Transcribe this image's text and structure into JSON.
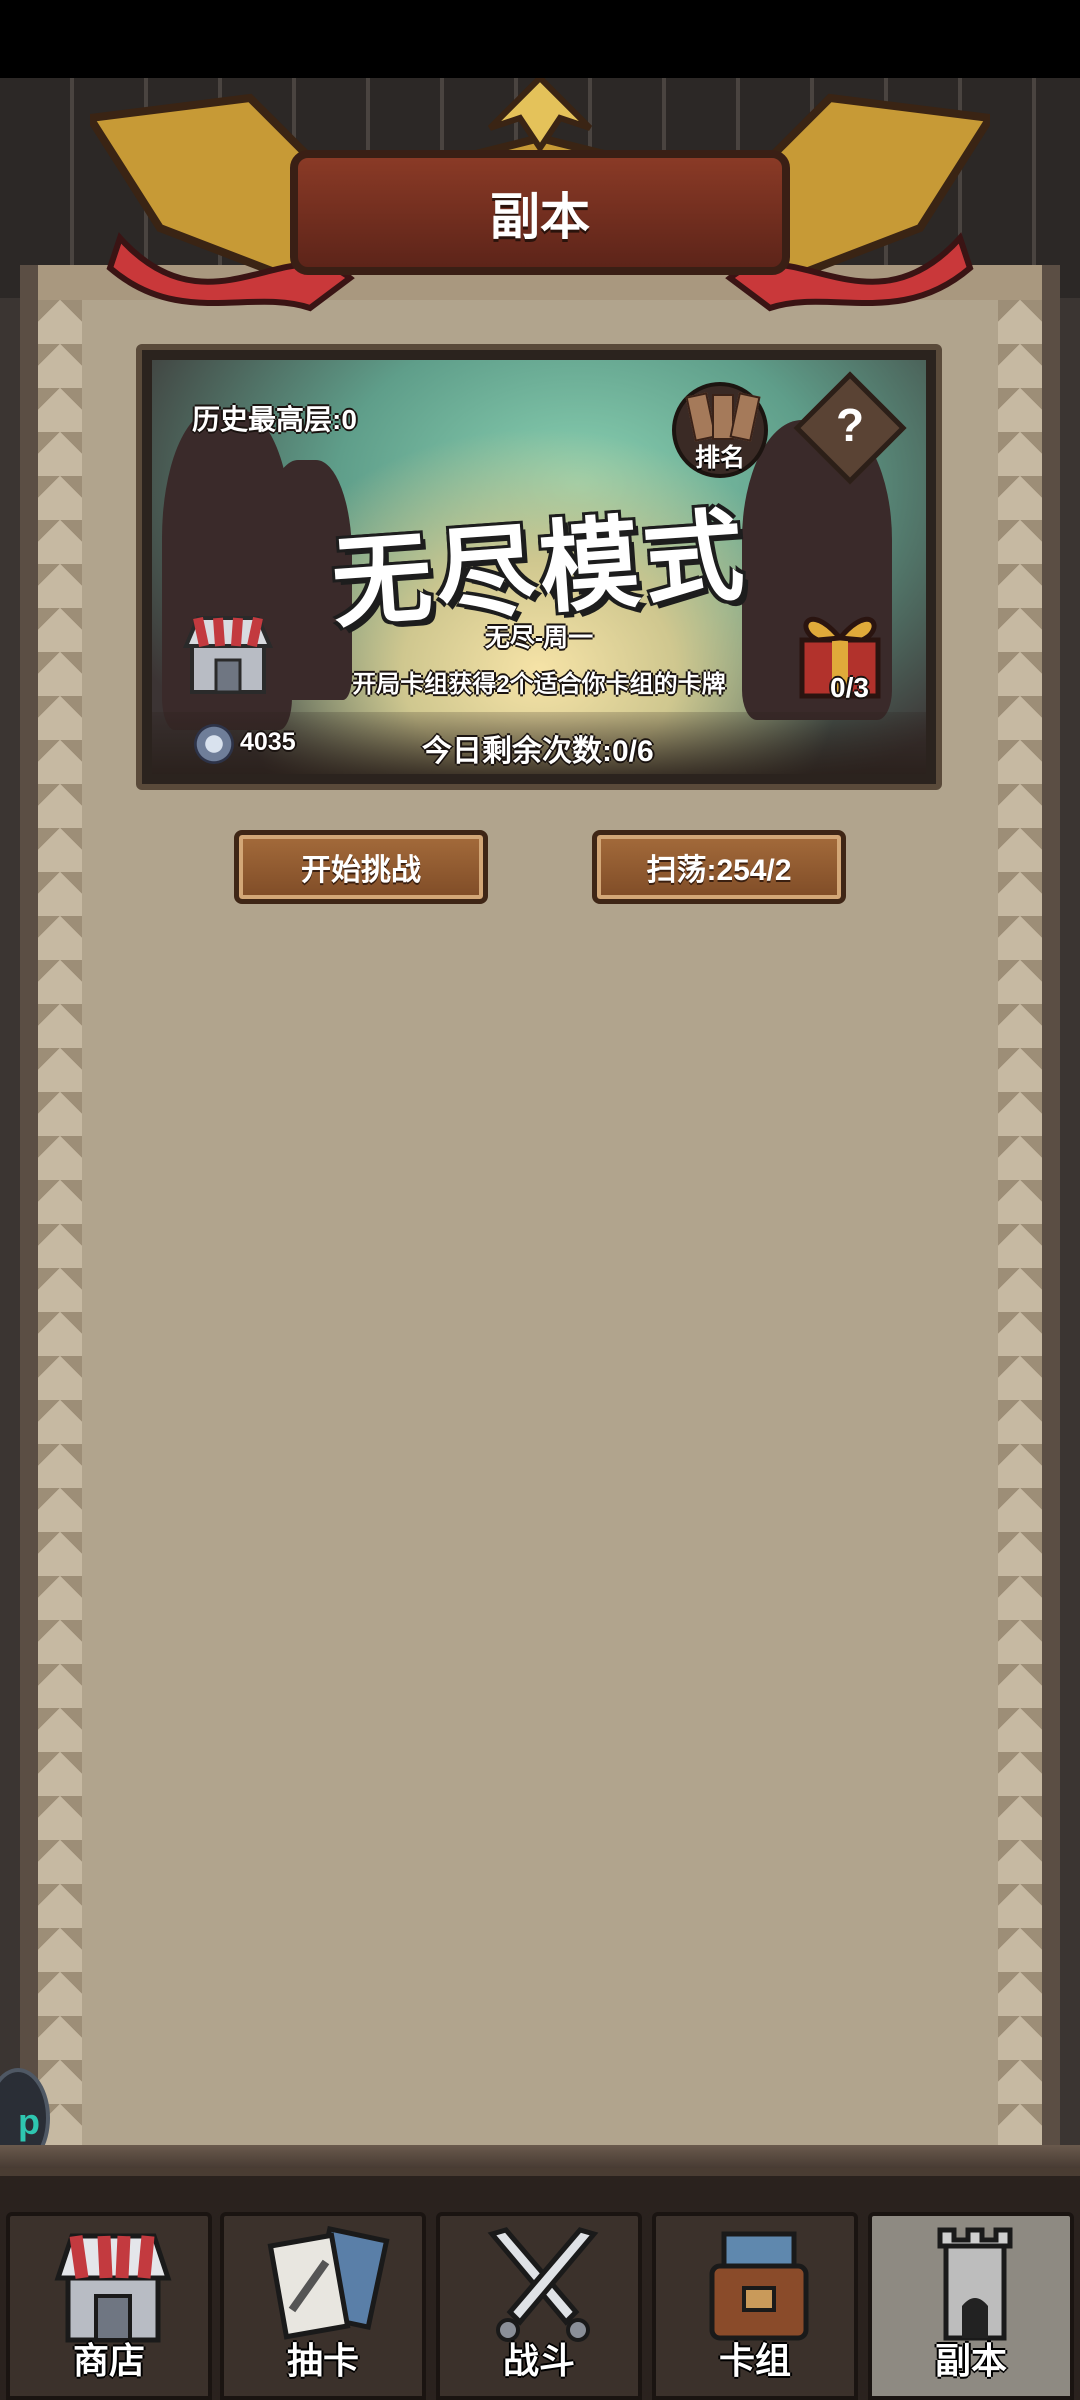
{
  "header": {
    "title": "副本"
  },
  "mode_card": {
    "title": "无尽模式",
    "best_floor": "历史最高层:0",
    "rank_label": "排名",
    "help_icon": "question-diamond-icon",
    "subtitle": "无尽-周一",
    "description": "开局卡组获得2个适合你卡组的卡牌",
    "coin_count": "4035",
    "remaining": "今日剩余次数:0/6",
    "reward_progress": "0/3"
  },
  "actions": {
    "start_label": "开始挑战",
    "sweep_label": "扫荡:254/2"
  },
  "floating": {
    "label": "p"
  },
  "nav": {
    "items": [
      {
        "label": "商店",
        "icon": "shop-icon"
      },
      {
        "label": "抽卡",
        "icon": "draw-card-icon"
      },
      {
        "label": "战斗",
        "icon": "crossed-swords-icon"
      },
      {
        "label": "卡组",
        "icon": "card-deck-icon"
      },
      {
        "label": "副本",
        "icon": "castle-tower-icon"
      }
    ],
    "active": "副本"
  },
  "colors": {
    "panel_bg": "#b1a48d",
    "button_brown": "#a46b3b",
    "title_plate_red": "#8a3a26",
    "nav_active": "#8e8a82"
  }
}
